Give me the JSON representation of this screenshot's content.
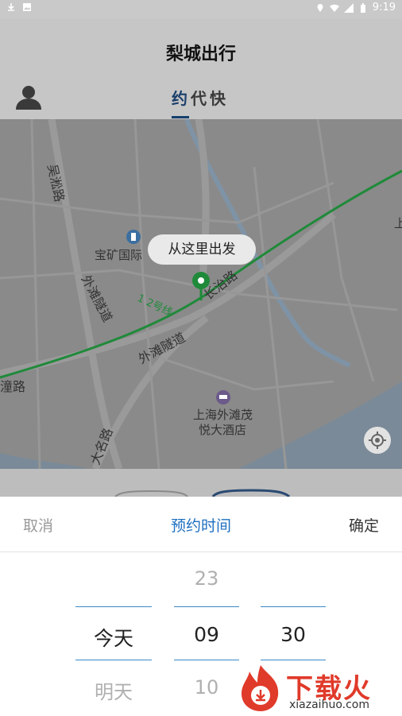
{
  "status_bar": {
    "time": "9:19"
  },
  "app": {
    "title": "梨城出行"
  },
  "tabs": [
    {
      "label": "约",
      "active": true
    },
    {
      "label": "代",
      "active": false
    },
    {
      "label": "快",
      "active": false
    }
  ],
  "map": {
    "pickup_bubble": "从这里出发",
    "labels": {
      "road_wusong": "吴淞路",
      "poi_baokuang": "宝矿国际",
      "metro_line": "1 2号线",
      "road_changzhi": "长治路",
      "road_waitan_tunnel_1": "外滩隧道",
      "road_waitan_tunnel_2": "外滩隧道",
      "road_tong": "潼路",
      "road_daming": "大名路",
      "hotel_line1": "上海外滩茂",
      "hotel_line2": "悦大酒店",
      "edge_fragment": "上"
    }
  },
  "picker": {
    "cancel": "取消",
    "title": "预约时间",
    "confirm": "确定",
    "day": {
      "selected": "今天",
      "next": "明天"
    },
    "hour": {
      "prev": "23",
      "selected": "09",
      "next": "10"
    },
    "minute": {
      "selected": "30"
    }
  },
  "watermark": {
    "brand": "下载火",
    "url": "xiazaihuo.com"
  },
  "colors": {
    "accent": "#1e6fc0",
    "metro_line": "#1f8a3a",
    "watermark_red": "#e03a2a"
  }
}
